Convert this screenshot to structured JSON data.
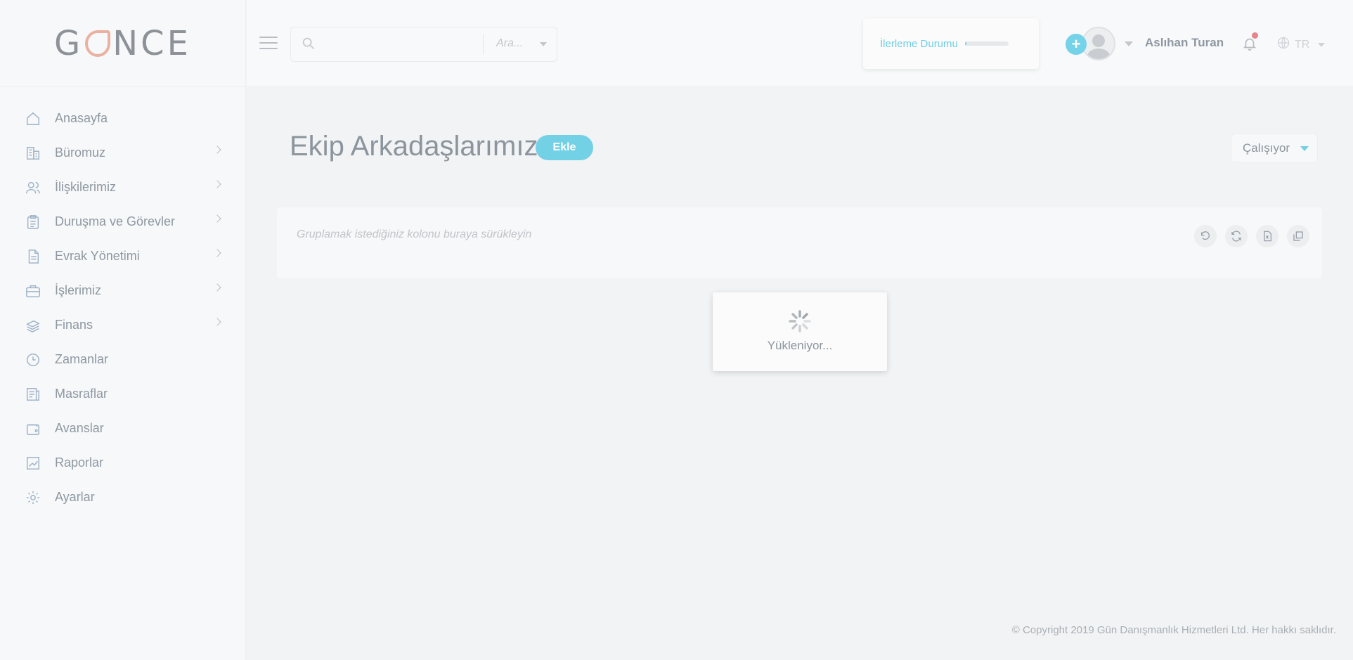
{
  "brand": {
    "logo_text_left": "G",
    "logo_text_right": "NCE",
    "accent": "#73d1e6",
    "logo_mark_color": "#eab1a1"
  },
  "sidebar": {
    "items": [
      {
        "label": "Anasayfa",
        "icon": "home-icon",
        "has_children": false
      },
      {
        "label": "Büromuz",
        "icon": "building-icon",
        "has_children": true
      },
      {
        "label": "İlişkilerimiz",
        "icon": "users-icon",
        "has_children": true
      },
      {
        "label": "Duruşma ve Görevler",
        "icon": "clipboard-icon",
        "has_children": true
      },
      {
        "label": "Evrak Yönetimi",
        "icon": "document-icon",
        "has_children": true
      },
      {
        "label": "İşlerimiz",
        "icon": "briefcase-icon",
        "has_children": true
      },
      {
        "label": "Finans",
        "icon": "money-icon",
        "has_children": true
      },
      {
        "label": "Zamanlar",
        "icon": "clock-icon",
        "has_children": false
      },
      {
        "label": "Masraflar",
        "icon": "receipt-icon",
        "has_children": false
      },
      {
        "label": "Avanslar",
        "icon": "wallet-icon",
        "has_children": false
      },
      {
        "label": "Raporlar",
        "icon": "chart-icon",
        "has_children": false
      },
      {
        "label": "Ayarlar",
        "icon": "gear-icon",
        "has_children": false
      }
    ]
  },
  "header": {
    "search": {
      "value": "",
      "placeholder": "",
      "scope": "Ara..."
    },
    "progress": {
      "label": "İlerleme Durumu",
      "value_percent": 4
    },
    "user": {
      "name": "Aslıhan Turan"
    },
    "language": "TR",
    "add_symbol": "+"
  },
  "main": {
    "title": "Ekip Arkadaşlarımız",
    "add_button": "Ekle",
    "status_filter": "Çalışıyor",
    "group_hint": "Gruplamak istediğiniz kolonu buraya sürükleyin",
    "loading_text": "Yükleniyor..."
  },
  "footer": {
    "copyright": "© Copyright 2019 Gün Danışmanlık Hizmetleri Ltd. Her hakkı saklıdır."
  }
}
